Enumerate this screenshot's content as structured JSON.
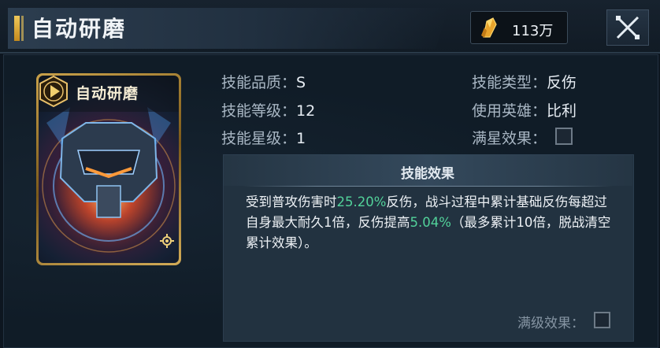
{
  "header": {
    "title": "自动研磨",
    "currency_amount": "113万",
    "currency_icon": "crystal-icon",
    "close_icon": "close-icon"
  },
  "card": {
    "name": "自动研磨",
    "emblem_icon": "skill-emblem-icon",
    "gear_icon": "gear-icon"
  },
  "stats": {
    "quality_label": "技能品质：",
    "quality_value": "S",
    "level_label": "技能等级：",
    "level_value": "12",
    "star_label": "技能星级：",
    "star_value": "1",
    "type_label": "技能类型：",
    "type_value": "反伤",
    "hero_label": "使用英雄：",
    "hero_value": "比利",
    "full_star_label": "满星效果："
  },
  "effect": {
    "title": "技能效果",
    "text_1": "受到普攻伤害时",
    "value_1": "25.20%",
    "text_2": "反伤，战斗过程中累计基础反伤每超过自身最大耐久1倍，反伤提高",
    "value_2": "5.04%",
    "text_3": "（最多累计10倍，脱战清空累计效果）。",
    "max_level_label": "满级效果："
  },
  "colors": {
    "highlight": "#52d29a",
    "accent_gold": "#f0c85a",
    "background": "#0d1620"
  }
}
